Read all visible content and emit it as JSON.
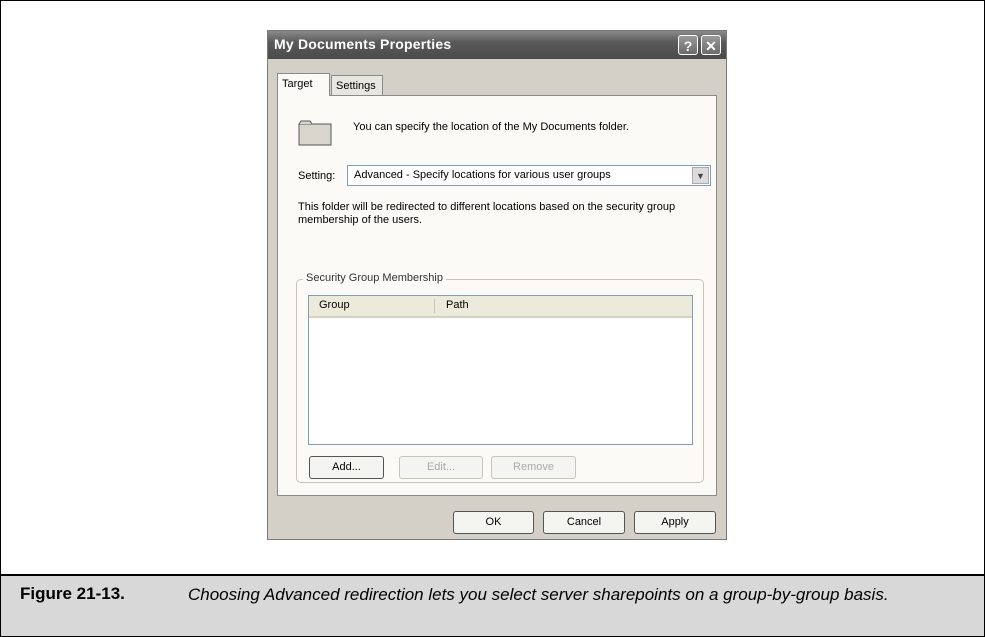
{
  "dialog": {
    "title": "My Documents Properties",
    "help_glyph": "?",
    "close_glyph": "✕",
    "tabs": [
      {
        "label": "Target",
        "active": true
      },
      {
        "label": "Settings",
        "active": false
      }
    ],
    "hint": "You can specify the location of the My Documents folder.",
    "setting_label": "Setting:",
    "setting_value": "Advanced - Specify locations for various user groups",
    "description": "This folder will be redirected to different locations based on the security group membership of the users.",
    "group_title": "Security Group Membership",
    "columns": [
      "Group",
      "Path"
    ],
    "buttons": {
      "add": "Add...",
      "edit": "Edit...",
      "remove": "Remove",
      "ok": "OK",
      "cancel": "Cancel",
      "apply": "Apply"
    }
  },
  "caption": {
    "label": "Figure 21-13.",
    "text": "Choosing Advanced redirection lets you select server sharepoints on a group-by-group basis."
  },
  "icons": {
    "folder": "folder-icon",
    "dropdown": "chevron-down-icon"
  }
}
